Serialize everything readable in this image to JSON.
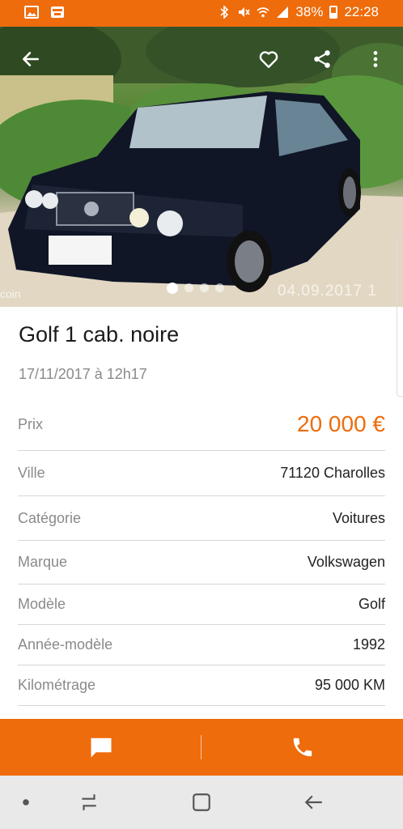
{
  "status_bar": {
    "battery": "38%",
    "time": "22:28"
  },
  "hero": {
    "watermark_left": "coin",
    "watermark_date": "04.09.2017  1",
    "dots": [
      true,
      false,
      false,
      false
    ]
  },
  "listing": {
    "title": "Golf 1 cab. noire",
    "date": "17/11/2017 à 12h17",
    "details": [
      {
        "label": "Prix",
        "value": "20 000 €"
      },
      {
        "label": "Ville",
        "value": "71120 Charolles"
      },
      {
        "label": "Catégorie",
        "value": "Voitures"
      },
      {
        "label": "Marque",
        "value": "Volkswagen"
      },
      {
        "label": "Modèle",
        "value": "Golf"
      },
      {
        "label": "Année-modèle",
        "value": "1992"
      },
      {
        "label": "Kilométrage",
        "value": "95 000 KM"
      }
    ]
  },
  "colors": {
    "accent": "#ee6c0b",
    "label": "#8a8a8a",
    "divider": "#d6d6d6"
  },
  "icons": [
    "image-icon",
    "bfm-tv-icon",
    "bluetooth-icon",
    "mute-icon",
    "wifi-icon",
    "signal-icon",
    "battery-icon",
    "back-arrow-icon",
    "heart-icon",
    "share-icon",
    "more-vertical-icon",
    "message-icon",
    "phone-icon",
    "recent-apps-icon",
    "home-icon",
    "nav-back-icon"
  ]
}
